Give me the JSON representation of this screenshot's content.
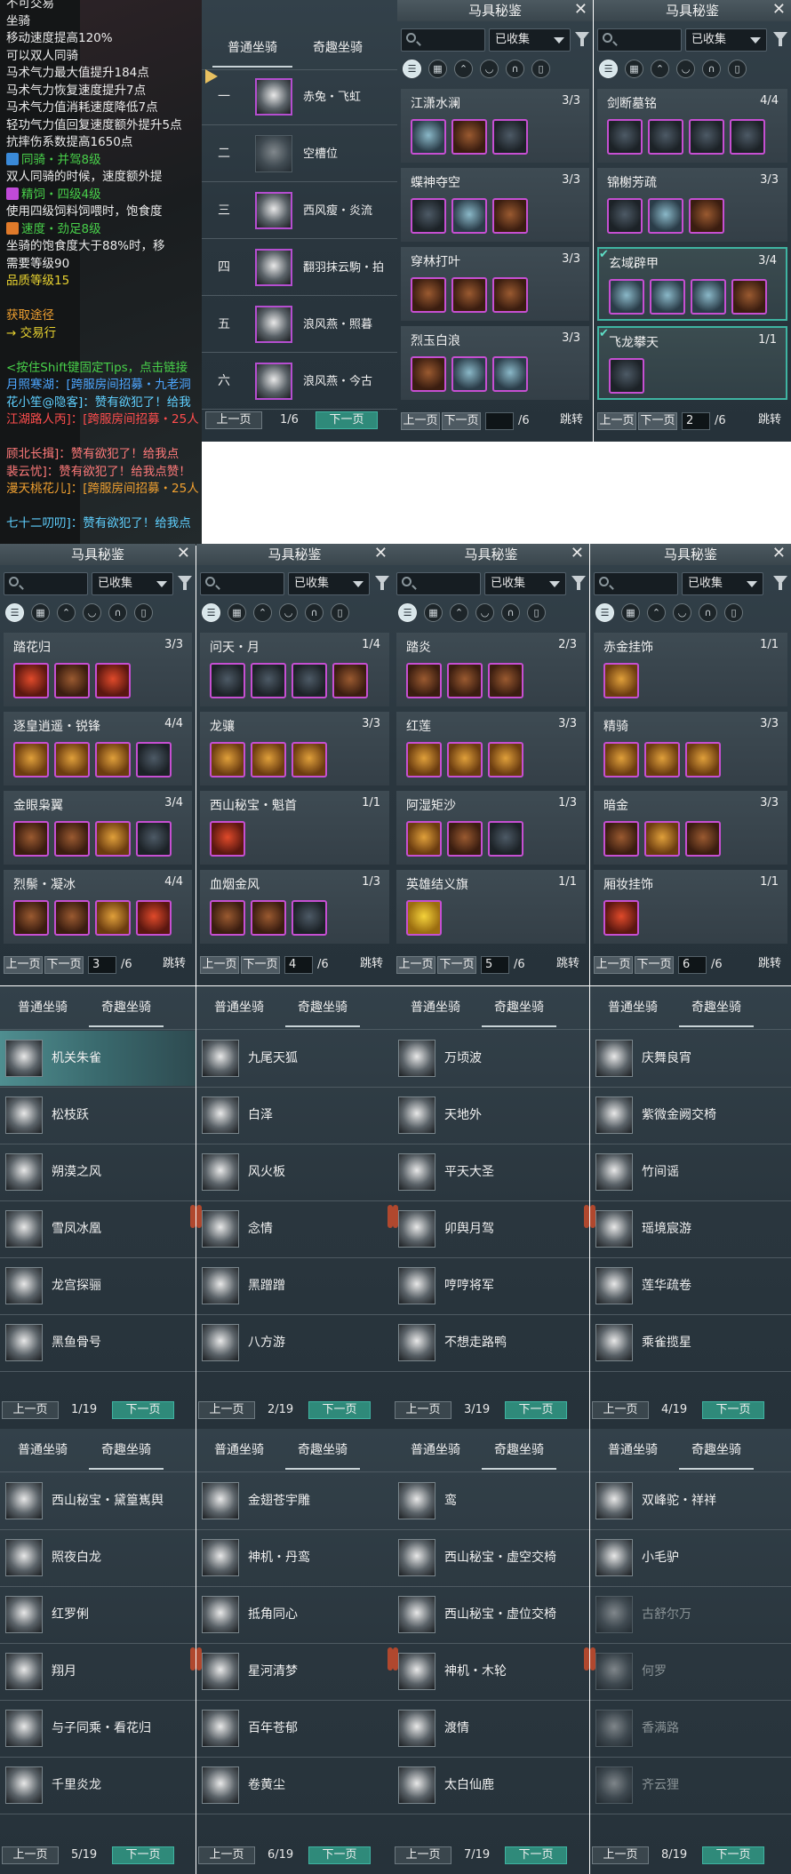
{
  "tooltip": {
    "lines": [
      {
        "text": "不可交易",
        "color": "white"
      },
      {
        "text": "坐骑",
        "color": "white"
      },
      {
        "text": "移动速度提高120%",
        "color": "white"
      },
      {
        "text": "可以双人同骑",
        "color": "white"
      },
      {
        "text": "马术气力最大值提升184点",
        "color": "white"
      },
      {
        "text": "马术气力恢复速度提升7点",
        "color": "white"
      },
      {
        "text": "马术气力值消耗速度降低7点",
        "color": "white"
      },
      {
        "text": "轻功气力值回复速度额外提升5点",
        "color": "white"
      },
      {
        "text": "抗摔伤系数提高1650点",
        "color": "white"
      },
      {
        "text": "同骑・并驾8级",
        "color": "green",
        "icon": "#3a8ad8"
      },
      {
        "text": "双人同骑的时候，速度额外提",
        "color": "white"
      },
      {
        "text": "精饲・四级4级",
        "color": "green",
        "icon": "#c04ad8"
      },
      {
        "text": "使用四级饲料饲喂时，饱食度",
        "color": "white"
      },
      {
        "text": "速度・劲足8级",
        "color": "green",
        "icon": "#e07a2a"
      },
      {
        "text": "坐骑的饱食度大于88%时，移",
        "color": "white"
      },
      {
        "text": "需要等级90",
        "color": "white"
      },
      {
        "text": "品质等级15",
        "color": "yellow"
      },
      {
        "text": "",
        "color": "white"
      },
      {
        "text": "获取途径",
        "color": "orange"
      },
      {
        "text": "→ 交易行",
        "color": "yellow"
      },
      {
        "text": "",
        "color": "white"
      },
      {
        "text": "<按住Shift键固定Tips，点击链接",
        "color": "green"
      },
      {
        "text": "月照寒湖：[跨服房间招募・九老洞",
        "color": "blue"
      },
      {
        "text": "花小笙@隐客]：赞有欲犯了！给我",
        "color": "cyan"
      },
      {
        "text": "江湖路人丙]：[跨服房间招募・25人",
        "color": "red"
      },
      {
        "text": "",
        "color": "white"
      },
      {
        "text": "顾北长揖]：赞有欲犯了！给我点",
        "color": "pink"
      },
      {
        "text": "裴云忧]：赞有欲犯了！给我点赞！",
        "color": "pink"
      },
      {
        "text": "漫天桃花儿]：[跨服房间招募・25人",
        "color": "orange"
      },
      {
        "text": "",
        "color": "white"
      },
      {
        "text": "七十二叨叨]：赞有欲犯了！给我点",
        "color": "cyan"
      }
    ]
  },
  "common": {
    "codex_title": "马具秘鉴",
    "filter_value": "已收集",
    "prev_label": "上一页",
    "next_label": "下一页",
    "jump_label": "跳转",
    "total_pages": "/6",
    "tab_normal": "普通坐骑",
    "tab_fun": "奇趣坐骑"
  },
  "codex_panels": [
    {
      "page": "",
      "sets": [
        {
          "name": "江潇水澜",
          "count": "3/3",
          "slots": [
            "teal",
            "brown",
            "dark"
          ],
          "done": false
        },
        {
          "name": "蝶神夺空",
          "count": "3/3",
          "slots": [
            "dark",
            "teal",
            "brown"
          ],
          "done": false
        },
        {
          "name": "穿林打叶",
          "count": "3/3",
          "slots": [
            "brown",
            "brown",
            "brown"
          ],
          "done": false
        },
        {
          "name": "烈玉白浪",
          "count": "3/3",
          "slots": [
            "brown",
            "teal",
            "teal"
          ],
          "done": false
        }
      ]
    },
    {
      "page": "2",
      "sets": [
        {
          "name": "剑断墓铭",
          "count": "4/4",
          "slots": [
            "dark",
            "dark",
            "dark",
            "dark"
          ],
          "done": false
        },
        {
          "name": "锦榭芳疏",
          "count": "3/3",
          "slots": [
            "dark",
            "teal",
            "brown"
          ],
          "done": false
        },
        {
          "name": "玄域辟甲",
          "count": "3/4",
          "slots": [
            "teal",
            "teal",
            "teal",
            "brown"
          ],
          "done": true
        },
        {
          "name": "飞龙攀天",
          "count": "1/1",
          "slots": [
            "dark"
          ],
          "done": true
        }
      ]
    },
    {
      "page": "3",
      "sets": [
        {
          "name": "踏花归",
          "count": "3/3",
          "slots": [
            "red",
            "brown",
            "red"
          ],
          "done": false
        },
        {
          "name": "逐皇逍遥・锐锋",
          "count": "4/4",
          "slots": [
            "gold",
            "gold",
            "gold",
            "dark"
          ],
          "done": false
        },
        {
          "name": "金眼枭翼",
          "count": "3/4",
          "slots": [
            "brown",
            "brown",
            "gold",
            "dark"
          ],
          "done": false
        },
        {
          "name": "烈鬃・凝冰",
          "count": "4/4",
          "slots": [
            "brown",
            "brown",
            "gold",
            "red"
          ],
          "done": false
        }
      ]
    },
    {
      "page": "4",
      "sets": [
        {
          "name": "问天・月",
          "count": "1/4",
          "slots": [
            "dark",
            "dark",
            "dark",
            "brown"
          ],
          "done": false
        },
        {
          "name": "龙骧",
          "count": "3/3",
          "slots": [
            "gold",
            "gold",
            "gold"
          ],
          "done": false
        },
        {
          "name": "西山秘宝・魁首",
          "count": "1/1",
          "slots": [
            "red"
          ],
          "done": false
        },
        {
          "name": "血烟金风",
          "count": "1/3",
          "slots": [
            "brown",
            "brown",
            "dark"
          ],
          "done": false
        }
      ]
    },
    {
      "page": "5",
      "sets": [
        {
          "name": "踏炎",
          "count": "2/3",
          "slots": [
            "brown",
            "brown",
            "brown"
          ],
          "done": false
        },
        {
          "name": "红莲",
          "count": "3/3",
          "slots": [
            "gold",
            "gold",
            "gold"
          ],
          "done": false
        },
        {
          "name": "阿湿矩沙",
          "count": "1/3",
          "slots": [
            "gold",
            "brown",
            "dark"
          ],
          "done": false
        },
        {
          "name": "英雄结义旗",
          "count": "1/1",
          "slots": [
            "yellow"
          ],
          "done": false
        }
      ]
    },
    {
      "page": "6",
      "sets": [
        {
          "name": "赤金挂饰",
          "count": "1/1",
          "slots": [
            "gold"
          ],
          "done": false
        },
        {
          "name": "精骑",
          "count": "3/3",
          "slots": [
            "gold",
            "gold",
            "gold"
          ],
          "done": false
        },
        {
          "name": "暗金",
          "count": "3/3",
          "slots": [
            "brown",
            "gold",
            "brown"
          ],
          "done": false
        },
        {
          "name": "厢妆挂饰",
          "count": "1/1",
          "slots": [
            "red"
          ],
          "done": false
        }
      ]
    }
  ],
  "stable_panel": {
    "page": "1/6",
    "rows": [
      {
        "num": "一",
        "name": "赤兔・飞虹",
        "empty": false
      },
      {
        "num": "二",
        "name": "空槽位",
        "empty": true
      },
      {
        "num": "三",
        "name": "西风瘦・炎流",
        "empty": false
      },
      {
        "num": "四",
        "name": "翻羽抹云駒・拍",
        "empty": false
      },
      {
        "num": "五",
        "name": "浪风燕・照暮",
        "empty": false
      },
      {
        "num": "六",
        "name": "浪风燕・今古",
        "empty": false
      }
    ]
  },
  "fun_panels": [
    {
      "page": "1/19",
      "items": [
        "机关朱雀",
        "松枝跃",
        "朔漠之风",
        "雪凤冰凰",
        "龙宫探骊",
        "黑鱼骨号"
      ]
    },
    {
      "page": "2/19",
      "items": [
        "九尾天狐",
        "白泽",
        "风火板",
        "念情",
        "黑蹭蹭",
        "八方游"
      ]
    },
    {
      "page": "3/19",
      "items": [
        "万顷波",
        "天地外",
        "平天大圣",
        "卯舆月驾",
        "哼哼将军",
        "不想走路鸭"
      ]
    },
    {
      "page": "4/19",
      "items": [
        "庆舞良宵",
        "紫微金阙交椅",
        "竹间谣",
        "瑶境宸游",
        "莲华疏卷",
        "乘雀揽星"
      ]
    },
    {
      "page": "5/19",
      "items": [
        "西山秘宝・黛篁嶲舆",
        "照夜白龙",
        "红罗俐",
        "翔月",
        "与子同乘・看花归",
        "千里炎龙"
      ]
    },
    {
      "page": "6/19",
      "items": [
        "金翅苍宇雕",
        "神机・丹鸾",
        "抵角同心",
        "星河清梦",
        "百年苍郁",
        "卷黄尘"
      ]
    },
    {
      "page": "7/19",
      "items": [
        "鸾",
        "西山秘宝・虚空交椅",
        "西山秘宝・虚位交椅",
        "神机・木轮",
        "渡情",
        "太白仙鹿"
      ]
    },
    {
      "page": "8/19",
      "items": [
        "双峰驼・祥祥",
        "小毛驴",
        "古舒尔万",
        "何罗",
        "香满路",
        "齐云狸"
      ]
    }
  ]
}
